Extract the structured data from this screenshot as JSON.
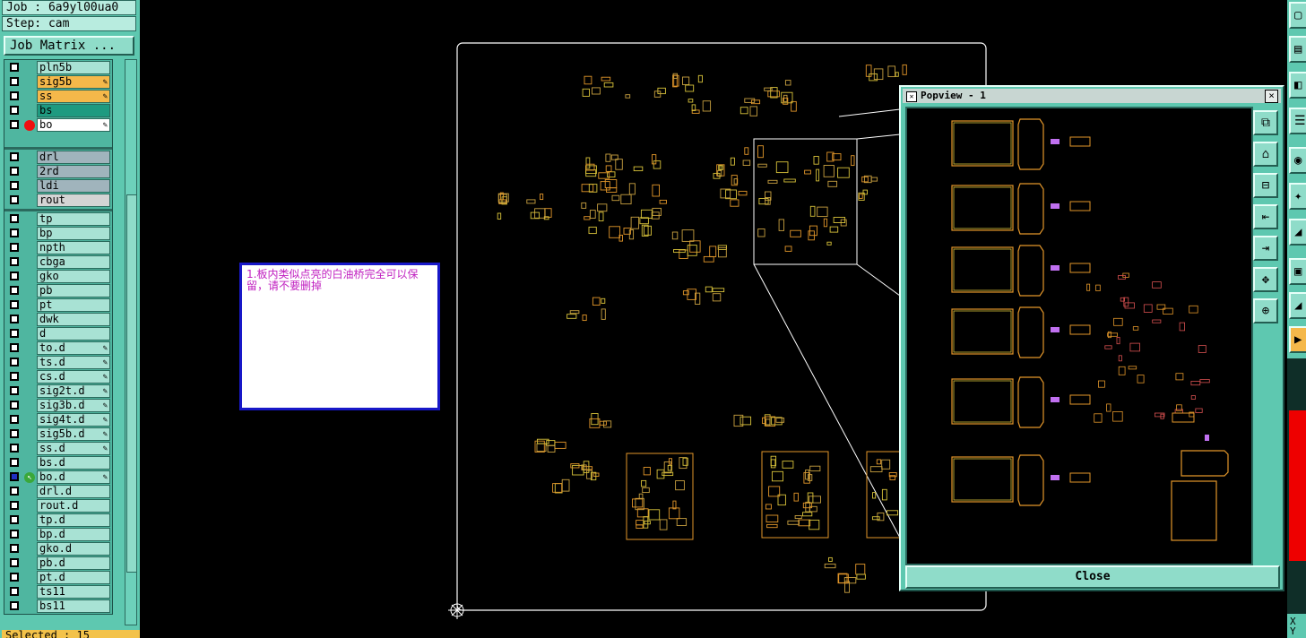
{
  "job": {
    "job_label": "Job : 6a9yl00ua0",
    "step_label": "Step: cam"
  },
  "job_matrix_button": "Job Matrix ...",
  "layers_top": [
    {
      "name": "pln5b",
      "color": "#a8e2d4"
    },
    {
      "name": "sig5b",
      "color": "#f5b84a",
      "editable": true
    },
    {
      "name": "ss",
      "color": "#f5b84a",
      "editable": true
    },
    {
      "name": "bs",
      "color": "#1e9a80"
    },
    {
      "name": "bo",
      "color": "#ffffff",
      "editable": true,
      "active_marker": "red-dot"
    }
  ],
  "layers_drill": [
    {
      "name": "drl",
      "color": "#a0b4bc"
    },
    {
      "name": "2rd",
      "color": "#a0b4bc"
    },
    {
      "name": "ldi",
      "color": "#a0b4bc"
    },
    {
      "name": "rout",
      "color": "#d4d4d4"
    }
  ],
  "layers_misc": [
    {
      "name": "tp"
    },
    {
      "name": "bp"
    },
    {
      "name": "npth"
    },
    {
      "name": "cbga"
    },
    {
      "name": "gko"
    },
    {
      "name": "pb"
    },
    {
      "name": "pt"
    },
    {
      "name": "dwk"
    },
    {
      "name": "d"
    },
    {
      "name": "to.d",
      "editable": true
    },
    {
      "name": "ts.d",
      "editable": true
    },
    {
      "name": "cs.d",
      "editable": true
    },
    {
      "name": "sig2t.d",
      "editable": true
    },
    {
      "name": "sig3b.d",
      "editable": true
    },
    {
      "name": "sig4t.d",
      "editable": true
    },
    {
      "name": "sig5b.d",
      "editable": true
    },
    {
      "name": "ss.d",
      "editable": true
    },
    {
      "name": "bs.d"
    },
    {
      "name": "bo.d",
      "editable": true,
      "work_marker": "green-arrow",
      "checked": true
    },
    {
      "name": "drl.d"
    },
    {
      "name": "rout.d"
    },
    {
      "name": "tp.d"
    },
    {
      "name": "bp.d"
    },
    {
      "name": "gko.d"
    },
    {
      "name": "pb.d"
    },
    {
      "name": "pt.d"
    },
    {
      "name": "ts11"
    },
    {
      "name": "bs11"
    }
  ],
  "selected_label": "Selected : 15",
  "note_text": "1.板内类似点亮的白油桥完全可以保留，请不要删掉",
  "popview": {
    "title": "Popview - 1",
    "close_label": "Close",
    "close_x": "×"
  },
  "popview_tools": [
    "zoom-home-icon",
    "pan-up-icon",
    "pan-down-icon",
    "pan-left-icon",
    "pan-right-icon",
    "zoom-fit-icon",
    "zoom-center-icon"
  ],
  "right_xy": "X Y",
  "colors": {
    "panel": "#5ec8b0",
    "board_outline": "#ffffff",
    "trace_orange": "#e2962a",
    "trace_yellow": "#d8c23a",
    "pad_purple": "#c070f0",
    "note_text": "#c020c0",
    "note_border": "#1818c8"
  }
}
